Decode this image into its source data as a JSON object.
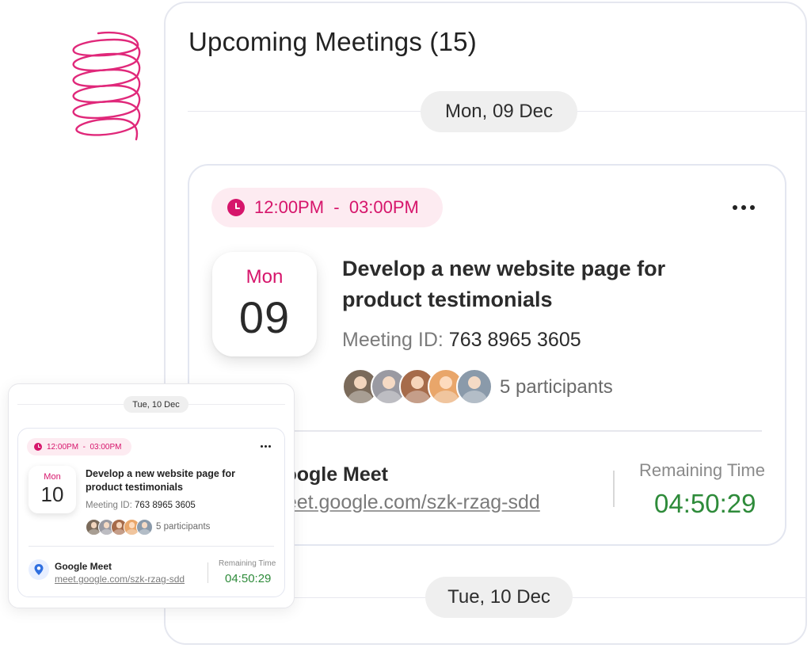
{
  "panel": {
    "title": "Upcoming Meetings (15)",
    "date_headers": [
      "Mon, 09 Dec",
      "Tue, 10 Dec"
    ]
  },
  "meeting": {
    "time_range": "12:00PM  -  03:00PM",
    "day_of_week": "Mon",
    "day_number": "09",
    "title": "Develop a new website page for product testimonials",
    "meeting_id_label": "Meeting ID:",
    "meeting_id": "763 8965 3605",
    "participants_text": "5 participants",
    "platform": "Google Meet",
    "link": "meet.google.com/szk-rzag-sdd",
    "remaining_label": "Remaining Time",
    "remaining_time": "04:50:29",
    "menu_icon": "more-horizontal-icon"
  },
  "mini": {
    "date_header": "Tue, 10 Dec",
    "time_range": "12:00PM  -  03:00PM",
    "day_of_week": "Mon",
    "day_number": "10",
    "title": "Develop a new website page for product testimonials",
    "meeting_id_label": "Meeting ID:",
    "meeting_id": "763 8965 3605",
    "participants_text": "5 participants",
    "platform": "Google Meet",
    "link": "meet.google.com/szk-rzag-sdd",
    "remaining_label": "Remaining Time",
    "remaining_time": "04:50:29",
    "location_icon": "location-pin-icon"
  },
  "colors": {
    "accent": "#d6156b",
    "accent_bg": "#fdebf1",
    "timer_green": "#2e8b3a",
    "pill_bg": "#efefef"
  }
}
